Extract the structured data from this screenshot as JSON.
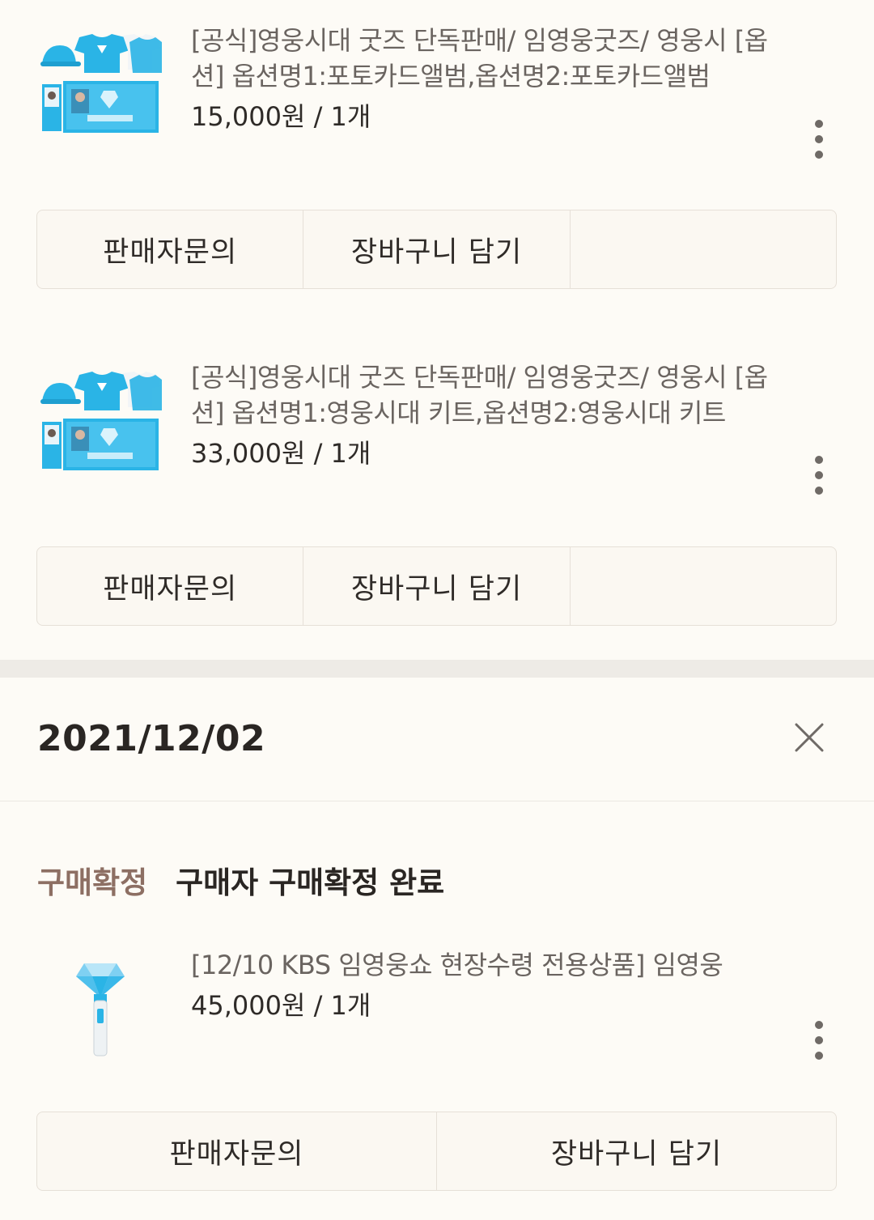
{
  "orders": [
    {
      "title": "[공식]영웅시대 굿즈 단독판매/ 임영웅굿즈/ 영웅시 [옵션] 옵션명1:포토카드앨범,옵션명2:포토카드앨범",
      "price": "15,000원 / 1개",
      "image": "goods-kit-image",
      "buttons": [
        "판매자문의",
        "장바구니 담기",
        ""
      ]
    },
    {
      "title": "[공식]영웅시대 굿즈 단독판매/ 임영웅굿즈/ 영웅시 [옵션] 옵션명1:영웅시대 키트,옵션명2:영웅시대 키트",
      "price": "33,000원 / 1개",
      "image": "goods-kit-image",
      "buttons": [
        "판매자문의",
        "장바구니 담기",
        ""
      ]
    }
  ],
  "section2": {
    "date": "2021/12/02",
    "status_label": "구매확정",
    "status_desc": "구매자 구매확정 완료",
    "item": {
      "title": "[12/10 KBS 임영웅쇼 현장수령 전용상품] 임영웅",
      "price": "45,000원 / 1개",
      "image": "lightstick-image",
      "buttons": [
        "판매자문의",
        "장바구니 담기"
      ]
    }
  },
  "colors": {
    "background": "#fdfbf6",
    "status_accent": "#8d6f63",
    "goods_blue": "#2ab4e6"
  }
}
